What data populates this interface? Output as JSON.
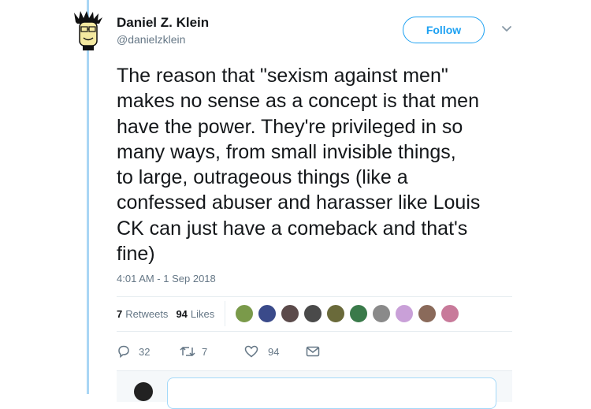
{
  "user": {
    "name": "Daniel Z. Klein",
    "handle": "@danielzklein",
    "avatar_icon": "cartoon-face-avatar"
  },
  "follow_button": {
    "label": "Follow"
  },
  "menu": {
    "icon": "chevron-down-icon"
  },
  "tweet": {
    "text": "The reason that \"sexism against men\"\nmakes no sense as a concept is that men\nhave the power. They're privileged in so\nmany ways, from small invisible things,\nto large, outrageous things (like a\nconfessed abuser and harasser like Louis\nCK can just have a comeback and that's\nfine)",
    "timestamp": "4:01 AM - 1 Sep 2018"
  },
  "stats": {
    "retweets_count": "7",
    "retweets_label": "Retweets",
    "likes_count": "94",
    "likes_label": "Likes"
  },
  "likers": [
    {
      "icon": "liker-avatar",
      "color": "#7a9a4a"
    },
    {
      "icon": "liker-avatar",
      "color": "#3a4a8a"
    },
    {
      "icon": "liker-avatar",
      "color": "#5b4a4a"
    },
    {
      "icon": "liker-avatar",
      "color": "#4a4a4a"
    },
    {
      "icon": "liker-avatar",
      "color": "#6a6a3a"
    },
    {
      "icon": "liker-avatar",
      "color": "#3a7a4a"
    },
    {
      "icon": "liker-avatar",
      "color": "#8a8a8a"
    },
    {
      "icon": "liker-avatar",
      "color": "#c9a0d8"
    },
    {
      "icon": "liker-avatar",
      "color": "#8a6a5a"
    },
    {
      "icon": "liker-avatar",
      "color": "#c87a9a"
    }
  ],
  "actions": {
    "reply_count": "32",
    "retweet_count": "7",
    "like_count": "94"
  },
  "colors": {
    "accent": "#1da1f2",
    "thread_line": "#a9d6f5",
    "muted_text": "#657786"
  }
}
